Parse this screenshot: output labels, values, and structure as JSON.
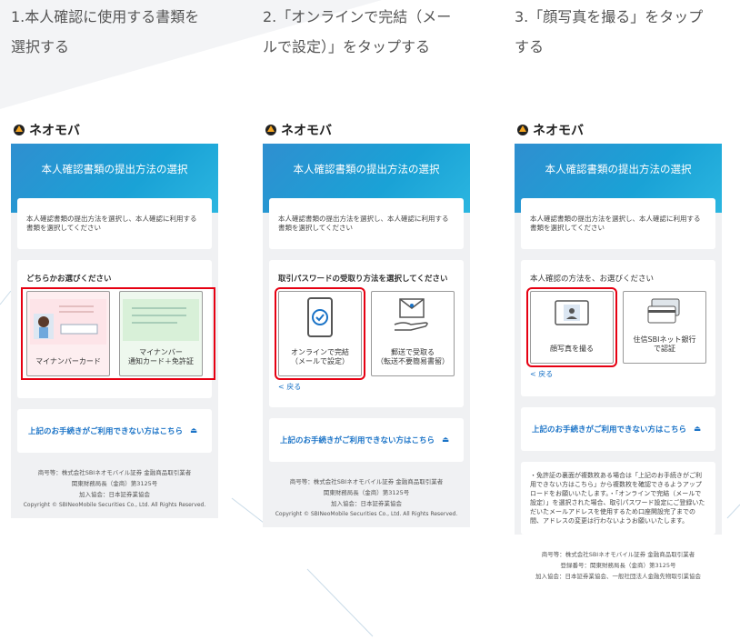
{
  "steps": [
    {
      "title_line1": "1.本人確認に使用する書類を",
      "title_line2": "選択する",
      "header": "本人確認書類の提出方法の選択",
      "description": "本人確認書類の提出方法を選択し、本人確認に利用する書類を選択してください",
      "prompt": "どちらかお選びください",
      "options": [
        {
          "label_line1": "マイナンバーカード",
          "label_line2": ""
        },
        {
          "label_line1": "マイナンバー",
          "label_line2": "通知カード＋免許証"
        }
      ],
      "link": "上記のお手続きがご利用できない方はこちら",
      "footer": [
        "商号等：株式会社SBIネオモバイル証券 金融商品取引業者",
        "関東財務局長（金商）第3125号",
        "加入協会：日本証券業協会",
        "Copyright © SBINeoMobile Securities Co., Ltd. All Rights Reserved."
      ]
    },
    {
      "title_line1": "2.「オンラインで完結（メー",
      "title_line2": "ルで設定）」をタップする",
      "header": "本人確認書類の提出方法の選択",
      "description": "本人確認書類の提出方法を選択し、本人確認に利用する書類を選択してください",
      "prompt": "取引パスワードの受取り方法を選択してください",
      "options": [
        {
          "label_line1": "オンラインで完結",
          "label_line2": "（メールで設定）"
        },
        {
          "label_line1": "郵送で受取る",
          "label_line2": "（転送不要簡易書留）"
        }
      ],
      "back": "< 戻る",
      "link": "上記のお手続きがご利用できない方はこちら",
      "footer": [
        "商号等：株式会社SBIネオモバイル証券 金融商品取引業者",
        "関東財務局長（金商）第3125号",
        "加入協会：日本証券業協会",
        "Copyright © SBINeoMobile Securities Co., Ltd. All Rights Reserved."
      ]
    },
    {
      "title_line1": "3.「顔写真を撮る」をタップ",
      "title_line2": "する",
      "header": "本人確認書類の提出方法の選択",
      "description": "本人確認書類の提出方法を選択し、本人確認に利用する書類を選択してください",
      "prompt": "本人確認の方法を、お選びください",
      "options": [
        {
          "label_line1": "顔写真を撮る",
          "label_line2": ""
        },
        {
          "label_line1": "住信SBIネット銀行",
          "label_line2": "で認証"
        }
      ],
      "back": "< 戻る",
      "link": "上記のお手続きがご利用できない方はこちら",
      "note": "・免許証の裏面が複数枚ある場合は「上記のお手続きがご利用できない方はこちら」から複数枚を確認できるようアップロードをお願いいたします。・「オンラインで完結（メールで設定）」を選択された場合、取引パスワード設定にご登録いただいたメールアドレスを使用するため口座開設完了までの間、アドレスの変更は行わないようお願いいたします。",
      "footer": [
        "商号等：株式会社SBIネオモバイル証券 金融商品取引業者",
        "登録番号：関東財務局長（金商）第3125号",
        "加入協会：日本証券業協会、一般社団法人金融先物取引業協会"
      ]
    }
  ],
  "logo_text": "ネオモバ",
  "colors": {
    "highlight": "#e60012",
    "header_start": "#2f8fd0",
    "header_end": "#2bb6e0",
    "link": "#1a73c7"
  }
}
